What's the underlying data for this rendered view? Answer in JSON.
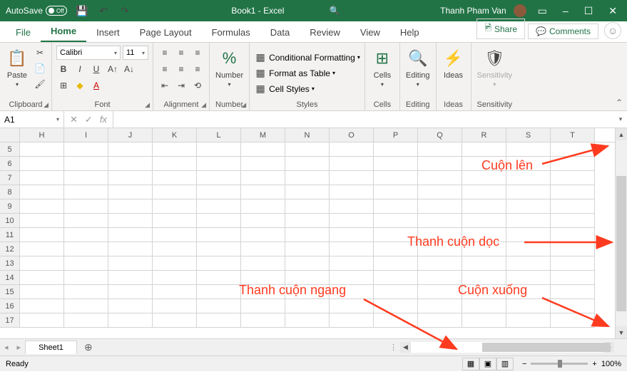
{
  "title": {
    "autosave": "AutoSave",
    "autosave_state": "Off",
    "doc": "Book1 - Excel",
    "user": "Thanh Pham Van"
  },
  "tabs": {
    "file": "File",
    "items": [
      "Home",
      "Insert",
      "Page Layout",
      "Formulas",
      "Data",
      "Review",
      "View",
      "Help"
    ],
    "active": 0,
    "share": "Share",
    "comments": "Comments"
  },
  "ribbon": {
    "clipboard": {
      "label": "Clipboard",
      "paste": "Paste"
    },
    "font": {
      "label": "Font",
      "name": "Calibri",
      "size": "11"
    },
    "alignment": {
      "label": "Alignment"
    },
    "number": {
      "label": "Number",
      "btn": "Number"
    },
    "styles": {
      "label": "Styles",
      "cf": "Conditional Formatting",
      "fat": "Format as Table",
      "cs": "Cell Styles"
    },
    "cells": {
      "label": "Cells",
      "btn": "Cells"
    },
    "editing": {
      "label": "Editing",
      "btn": "Editing"
    },
    "ideas": {
      "label": "Ideas",
      "btn": "Ideas"
    },
    "sens": {
      "label": "Sensitivity",
      "btn": "Sensitivity"
    }
  },
  "formula": {
    "namebox": "A1"
  },
  "columns": [
    "H",
    "I",
    "J",
    "K",
    "L",
    "M",
    "N",
    "O",
    "P",
    "Q",
    "R",
    "S",
    "T"
  ],
  "rows": [
    "5",
    "6",
    "7",
    "8",
    "9",
    "10",
    "11",
    "12",
    "13",
    "14",
    "15",
    "16",
    "17"
  ],
  "sheet": {
    "name": "Sheet1"
  },
  "status": {
    "ready": "Ready",
    "zoom": "100%"
  },
  "anno": {
    "up": "Cuộn lên",
    "vbar": "Thanh cuộn dọc",
    "hbar": "Thanh cuộn ngang",
    "down": "Cuộn xuống"
  }
}
